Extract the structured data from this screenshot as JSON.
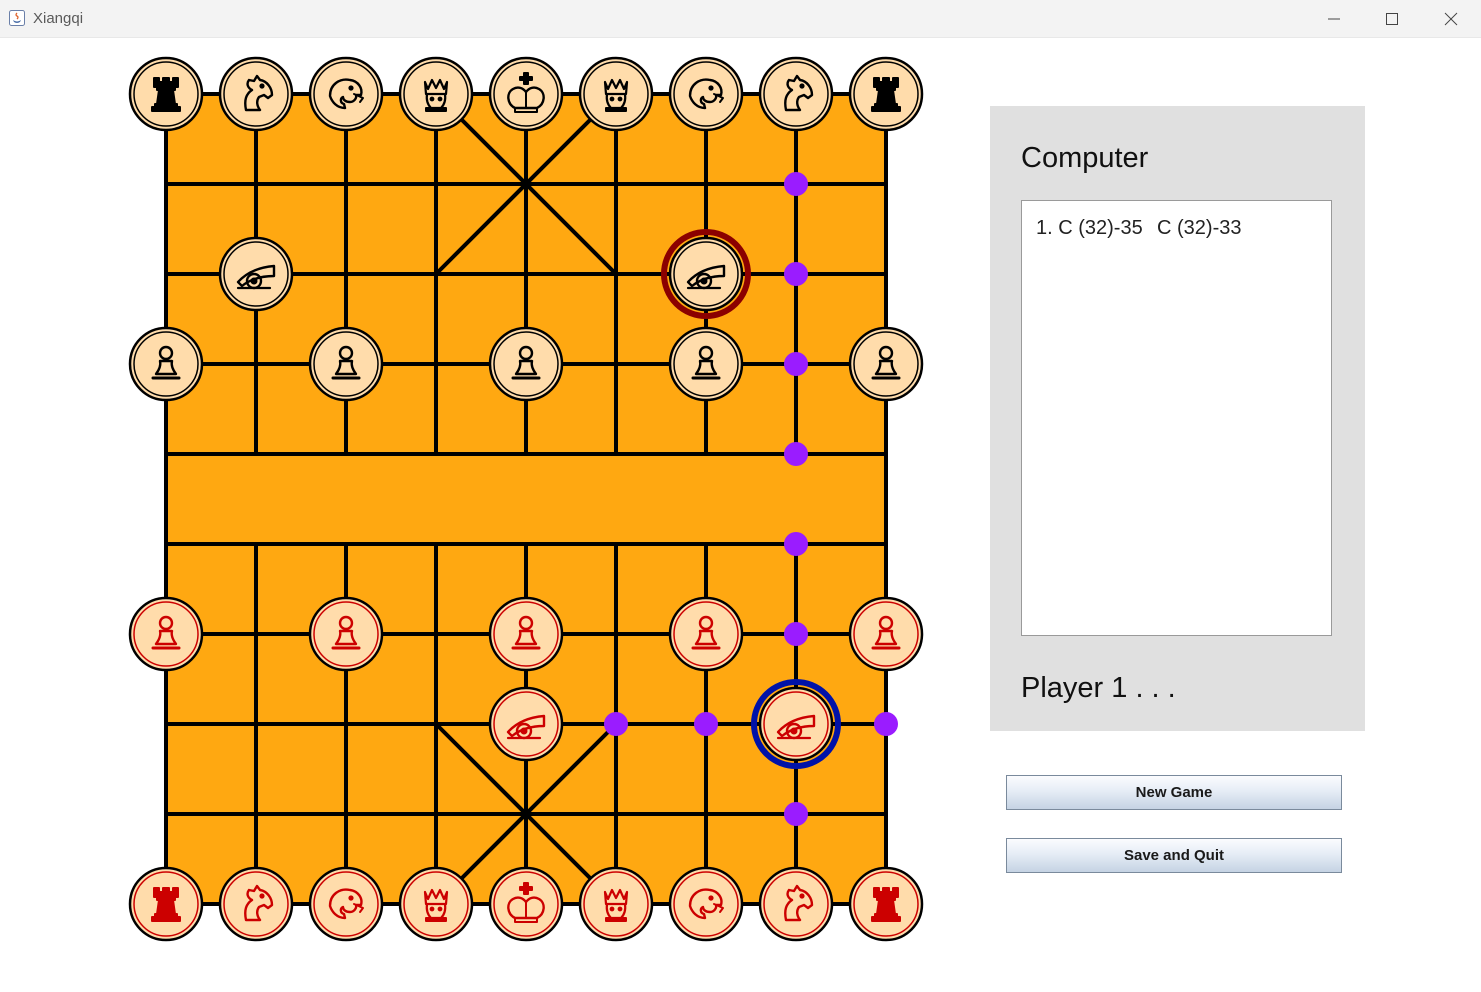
{
  "window": {
    "title": "Xiangqi"
  },
  "colors": {
    "board": "#ffa811",
    "board_line": "#000000",
    "piece_face": "#ffdcab",
    "black_piece": "#000000",
    "red_piece": "#cc0000",
    "marker": "#9a1cff",
    "last_move_ring": "#8b0000",
    "selected_ring": "#0012a8"
  },
  "board": {
    "pieces": [
      {
        "side": "black",
        "type": "rook",
        "icon": "rook-icon",
        "col": 0,
        "row": 0
      },
      {
        "side": "black",
        "type": "horse",
        "icon": "horse-icon",
        "col": 1,
        "row": 0
      },
      {
        "side": "black",
        "type": "elephant",
        "icon": "elephant-icon",
        "col": 2,
        "row": 0
      },
      {
        "side": "black",
        "type": "advisor",
        "icon": "advisor-icon",
        "col": 3,
        "row": 0
      },
      {
        "side": "black",
        "type": "general",
        "icon": "general-icon",
        "col": 4,
        "row": 0
      },
      {
        "side": "black",
        "type": "advisor",
        "icon": "advisor-icon",
        "col": 5,
        "row": 0
      },
      {
        "side": "black",
        "type": "elephant",
        "icon": "elephant-icon",
        "col": 6,
        "row": 0
      },
      {
        "side": "black",
        "type": "horse",
        "icon": "horse-icon",
        "col": 7,
        "row": 0
      },
      {
        "side": "black",
        "type": "rook",
        "icon": "rook-icon",
        "col": 8,
        "row": 0
      },
      {
        "side": "black",
        "type": "cannon",
        "icon": "cannon-icon",
        "col": 1,
        "row": 2
      },
      {
        "side": "black",
        "type": "cannon",
        "icon": "cannon-icon",
        "col": 6,
        "row": 2,
        "highlight": "last-move"
      },
      {
        "side": "black",
        "type": "soldier",
        "icon": "soldier-icon",
        "col": 0,
        "row": 3
      },
      {
        "side": "black",
        "type": "soldier",
        "icon": "soldier-icon",
        "col": 2,
        "row": 3
      },
      {
        "side": "black",
        "type": "soldier",
        "icon": "soldier-icon",
        "col": 4,
        "row": 3
      },
      {
        "side": "black",
        "type": "soldier",
        "icon": "soldier-icon",
        "col": 6,
        "row": 3
      },
      {
        "side": "black",
        "type": "soldier",
        "icon": "soldier-icon",
        "col": 8,
        "row": 3
      },
      {
        "side": "red",
        "type": "soldier",
        "icon": "soldier-icon",
        "col": 0,
        "row": 6
      },
      {
        "side": "red",
        "type": "soldier",
        "icon": "soldier-icon",
        "col": 2,
        "row": 6
      },
      {
        "side": "red",
        "type": "soldier",
        "icon": "soldier-icon",
        "col": 4,
        "row": 6
      },
      {
        "side": "red",
        "type": "soldier",
        "icon": "soldier-icon",
        "col": 6,
        "row": 6
      },
      {
        "side": "red",
        "type": "soldier",
        "icon": "soldier-icon",
        "col": 8,
        "row": 6
      },
      {
        "side": "red",
        "type": "cannon",
        "icon": "cannon-icon",
        "col": 4,
        "row": 7
      },
      {
        "side": "red",
        "type": "cannon",
        "icon": "cannon-icon",
        "col": 7,
        "row": 7,
        "highlight": "selected"
      },
      {
        "side": "red",
        "type": "rook",
        "icon": "rook-icon",
        "col": 0,
        "row": 9
      },
      {
        "side": "red",
        "type": "horse",
        "icon": "horse-icon",
        "col": 1,
        "row": 9
      },
      {
        "side": "red",
        "type": "elephant",
        "icon": "elephant-icon",
        "col": 2,
        "row": 9
      },
      {
        "side": "red",
        "type": "advisor",
        "icon": "advisor-icon",
        "col": 3,
        "row": 9
      },
      {
        "side": "red",
        "type": "general",
        "icon": "general-icon",
        "col": 4,
        "row": 9
      },
      {
        "side": "red",
        "type": "advisor",
        "icon": "advisor-icon",
        "col": 5,
        "row": 9
      },
      {
        "side": "red",
        "type": "elephant",
        "icon": "elephant-icon",
        "col": 6,
        "row": 9
      },
      {
        "side": "red",
        "type": "horse",
        "icon": "horse-icon",
        "col": 7,
        "row": 9
      },
      {
        "side": "red",
        "type": "rook",
        "icon": "rook-icon",
        "col": 8,
        "row": 9
      }
    ],
    "legal_moves": [
      {
        "col": 7,
        "row": 1
      },
      {
        "col": 7,
        "row": 2
      },
      {
        "col": 7,
        "row": 3
      },
      {
        "col": 7,
        "row": 4
      },
      {
        "col": 7,
        "row": 5
      },
      {
        "col": 7,
        "row": 6
      },
      {
        "col": 7,
        "row": 8
      },
      {
        "col": 5,
        "row": 7
      },
      {
        "col": 6,
        "row": 7
      },
      {
        "col": 8,
        "row": 7
      }
    ]
  },
  "panel": {
    "computer_label": "Computer",
    "moves": [
      {
        "red": "1. C (32)-35",
        "black": "C (32)-33"
      }
    ],
    "status": "Player 1 . . ."
  },
  "buttons": {
    "new_game": "New Game",
    "save_quit": "Save and Quit"
  }
}
